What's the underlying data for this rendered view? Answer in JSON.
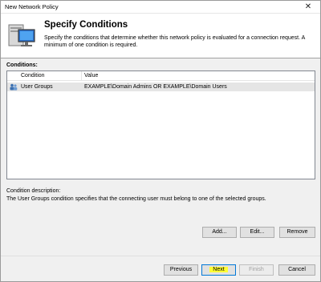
{
  "window": {
    "title": "New Network Policy",
    "close_label": "✕"
  },
  "header": {
    "title": "Specify Conditions",
    "description": "Specify the conditions that determine whether this network policy is evaluated for a connection request. A minimum of one condition is required."
  },
  "conditions": {
    "label": "Conditions:",
    "columns": [
      "Condition",
      "Value"
    ],
    "rows": [
      {
        "condition": "User Groups",
        "value": "EXAMPLE\\Domain Admins OR EXAMPLE\\Domain Users",
        "icon": "user-group-icon",
        "selected": true
      }
    ]
  },
  "description": {
    "label": "Condition description:",
    "text": "The User Groups condition specifies that the connecting user must belong to one of the selected groups."
  },
  "buttons": {
    "add": "Add...",
    "edit": "Edit...",
    "remove": "Remove",
    "previous": "Previous",
    "next": "Next",
    "finish": "Finish",
    "cancel": "Cancel"
  },
  "colors": {
    "highlight": "#ffff33",
    "focus_border": "#0078d7",
    "selected_row": "#e5e5e5"
  }
}
